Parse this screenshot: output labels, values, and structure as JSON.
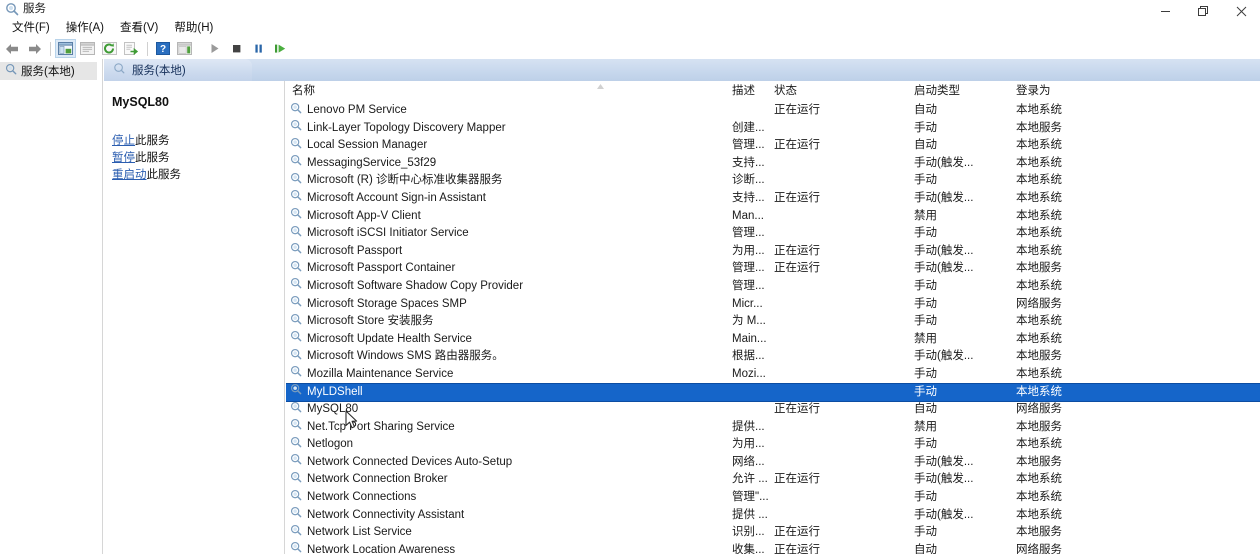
{
  "window": {
    "title": "服务",
    "icon": "services-icon",
    "controls": [
      {
        "name": "minimize-button",
        "glyph": "minimize-icon"
      },
      {
        "name": "maximize-button",
        "glyph": "maximize-icon"
      },
      {
        "name": "close-button",
        "glyph": "close-icon"
      }
    ]
  },
  "menubar": {
    "items": [
      {
        "label": "文件(F)",
        "name": "menu-file"
      },
      {
        "label": "操作(A)",
        "name": "menu-action"
      },
      {
        "label": "查看(V)",
        "name": "menu-view"
      },
      {
        "label": "帮助(H)",
        "name": "menu-help"
      }
    ]
  },
  "toolbar": {
    "buttons": [
      {
        "name": "back-button",
        "icon": "arrow-left-icon"
      },
      {
        "name": "forward-button",
        "icon": "arrow-right-icon"
      },
      {
        "name": "show-hide-tree-button",
        "icon": "tree-pane-icon"
      },
      {
        "name": "properties-button",
        "icon": "properties-icon"
      },
      {
        "name": "refresh-button",
        "icon": "refresh-icon"
      },
      {
        "name": "export-list-button",
        "icon": "export-icon"
      },
      {
        "name": "help-button",
        "icon": "help-icon"
      },
      {
        "name": "show-action-pane-button",
        "icon": "action-pane-icon"
      },
      {
        "name": "start-service-button",
        "icon": "play-icon"
      },
      {
        "name": "stop-service-button",
        "icon": "stop-icon"
      },
      {
        "name": "pause-service-button",
        "icon": "pause-icon"
      },
      {
        "name": "restart-service-button",
        "icon": "restart-icon"
      }
    ]
  },
  "tree": {
    "items": [
      {
        "label": "服务(本地)",
        "icon": "services-icon",
        "name": "tree-item-services-local"
      }
    ]
  },
  "tab": {
    "label": "服务(本地)",
    "icon": "services-icon"
  },
  "detail": {
    "title": "MySQL80",
    "links": [
      {
        "link_text": "停止",
        "rest_text": "此服务",
        "name": "stop-service-link"
      },
      {
        "link_text": "暂停",
        "rest_text": "此服务",
        "name": "pause-service-link"
      },
      {
        "link_text": "重启动",
        "rest_text": "此服务",
        "name": "restart-service-link"
      }
    ]
  },
  "list": {
    "columns": [
      {
        "label": "名称",
        "key": "name"
      },
      {
        "label": "描述",
        "key": "desc"
      },
      {
        "label": "状态",
        "key": "state"
      },
      {
        "label": "启动类型",
        "key": "startup"
      },
      {
        "label": "登录为",
        "key": "logon"
      }
    ],
    "selected_index": 16,
    "rows": [
      {
        "name": "Lenovo PM Service",
        "desc": "",
        "state": "正在运行",
        "startup": "自动",
        "logon": "本地系统"
      },
      {
        "name": "Link-Layer Topology Discovery Mapper",
        "desc": "创建...",
        "state": "",
        "startup": "手动",
        "logon": "本地服务"
      },
      {
        "name": "Local Session Manager",
        "desc": "管理...",
        "state": "正在运行",
        "startup": "自动",
        "logon": "本地系统"
      },
      {
        "name": "MessagingService_53f29",
        "desc": "支持...",
        "state": "",
        "startup": "手动(触发...",
        "logon": "本地系统"
      },
      {
        "name": "Microsoft (R) 诊断中心标准收集器服务",
        "desc": "诊断...",
        "state": "",
        "startup": "手动",
        "logon": "本地系统"
      },
      {
        "name": "Microsoft Account Sign-in Assistant",
        "desc": "支持...",
        "state": "正在运行",
        "startup": "手动(触发...",
        "logon": "本地系统"
      },
      {
        "name": "Microsoft App-V Client",
        "desc": "Man...",
        "state": "",
        "startup": "禁用",
        "logon": "本地系统"
      },
      {
        "name": "Microsoft iSCSI Initiator Service",
        "desc": "管理...",
        "state": "",
        "startup": "手动",
        "logon": "本地系统"
      },
      {
        "name": "Microsoft Passport",
        "desc": "为用...",
        "state": "正在运行",
        "startup": "手动(触发...",
        "logon": "本地系统"
      },
      {
        "name": "Microsoft Passport Container",
        "desc": "管理...",
        "state": "正在运行",
        "startup": "手动(触发...",
        "logon": "本地服务"
      },
      {
        "name": "Microsoft Software Shadow Copy Provider",
        "desc": "管理...",
        "state": "",
        "startup": "手动",
        "logon": "本地系统"
      },
      {
        "name": "Microsoft Storage Spaces SMP",
        "desc": "Micr...",
        "state": "",
        "startup": "手动",
        "logon": "网络服务"
      },
      {
        "name": "Microsoft Store 安装服务",
        "desc": "为 M...",
        "state": "",
        "startup": "手动",
        "logon": "本地系统"
      },
      {
        "name": "Microsoft Update Health Service",
        "desc": "Main...",
        "state": "",
        "startup": "禁用",
        "logon": "本地系统"
      },
      {
        "name": "Microsoft Windows SMS 路由器服务。",
        "desc": "根据...",
        "state": "",
        "startup": "手动(触发...",
        "logon": "本地服务"
      },
      {
        "name": "Mozilla Maintenance Service",
        "desc": "Mozi...",
        "state": "",
        "startup": "手动",
        "logon": "本地系统"
      },
      {
        "name": "MyLDShell",
        "desc": "",
        "state": "",
        "startup": "手动",
        "logon": "本地系统"
      },
      {
        "name": "MySQL80",
        "desc": "",
        "state": "正在运行",
        "startup": "自动",
        "logon": "网络服务"
      },
      {
        "name": "Net.Tcp Port Sharing Service",
        "desc": "提供...",
        "state": "",
        "startup": "禁用",
        "logon": "本地服务"
      },
      {
        "name": "Netlogon",
        "desc": "为用...",
        "state": "",
        "startup": "手动",
        "logon": "本地系统"
      },
      {
        "name": "Network Connected Devices Auto-Setup",
        "desc": "网络...",
        "state": "",
        "startup": "手动(触发...",
        "logon": "本地服务"
      },
      {
        "name": "Network Connection Broker",
        "desc": "允许 ...",
        "state": "正在运行",
        "startup": "手动(触发...",
        "logon": "本地系统"
      },
      {
        "name": "Network Connections",
        "desc": "管理\"...",
        "state": "",
        "startup": "手动",
        "logon": "本地系统"
      },
      {
        "name": "Network Connectivity Assistant",
        "desc": "提供 ...",
        "state": "",
        "startup": "手动(触发...",
        "logon": "本地系统"
      },
      {
        "name": "Network List Service",
        "desc": "识别...",
        "state": "正在运行",
        "startup": "手动",
        "logon": "本地服务"
      },
      {
        "name": "Network Location Awareness",
        "desc": "收集...",
        "state": "正在运行",
        "startup": "自动",
        "logon": "网络服务"
      }
    ]
  },
  "colors": {
    "selection": "#1565c9",
    "link": "#2a5db0",
    "tab_blue": "#c8d8ed"
  }
}
